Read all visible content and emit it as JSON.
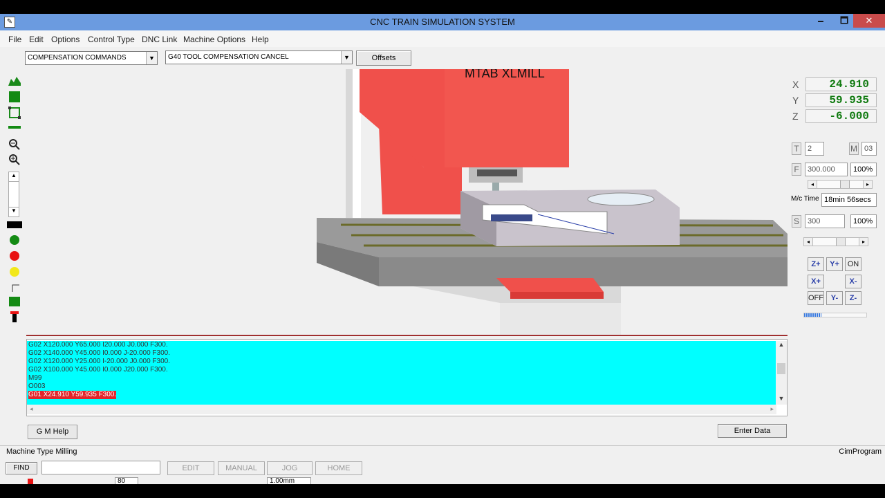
{
  "window": {
    "title": "CNC TRAIN SIMULATION SYSTEM",
    "minimize": "🗕",
    "maximize": "🗖",
    "close": "✕"
  },
  "menu": [
    "File",
    "Edit",
    "Options",
    "Control Type",
    "DNC Link",
    "Machine Options",
    "Help"
  ],
  "toolbar": {
    "command_group": "COMPENSATION COMMANDS",
    "command": "G40 TOOL COMPENSATION CANCEL",
    "offsets_label": "Offsets"
  },
  "viewport": {
    "machine_name": "MTAB XLMILL"
  },
  "dro": {
    "x_label": "X",
    "x": "24.910",
    "y_label": "Y",
    "y": "59.935",
    "z_label": "Z",
    "z": "-6.000"
  },
  "tool": {
    "t_label": "T",
    "t_value": "2",
    "m_label": "M",
    "m_value": "03"
  },
  "feed": {
    "label": "F",
    "value": "300.000",
    "override": "100%"
  },
  "machine_time": {
    "label": "M/c Time",
    "value": "18min 56secs"
  },
  "spindle": {
    "label": "S",
    "value": "300",
    "override": "100%"
  },
  "jog": {
    "z_plus": "Z+",
    "y_plus": "Y+",
    "on": "ON",
    "x_plus": "X+",
    "x_minus": "X-",
    "off": "OFF",
    "y_minus": "Y-",
    "z_minus": "Z-"
  },
  "program": {
    "lines": [
      "G02 X120.000 Y65.000 I20.000 J0.000 F300.",
      "G02 X140.000 Y45.000 I0.000 J-20.000 F300.",
      "G02 X120.000 Y25.000 I-20.000 J0.000 F300.",
      "G02 X100.000 Y45.000 I0.000 J20.000 F300.",
      "M99",
      "O003"
    ],
    "current_line": "G01 X24.910 Y59.935 F300."
  },
  "buttons": {
    "gm_help": "G M Help",
    "enter_data": "Enter Data"
  },
  "status": {
    "machine_type": "Machine Type  Milling",
    "program": "CimProgram"
  },
  "bottom": {
    "find": "FIND",
    "edit": "EDIT",
    "manual": "MANUAL",
    "jog": "JOG",
    "home": "HOME",
    "step": "1.00mm",
    "feed_value": "80"
  },
  "colors": {
    "title_bar": "#6b9be0",
    "code_bg": "#00ffff",
    "highlight": "#e3252a",
    "dro_text": "#0f7a0f",
    "machine_red": "#f0504b"
  }
}
